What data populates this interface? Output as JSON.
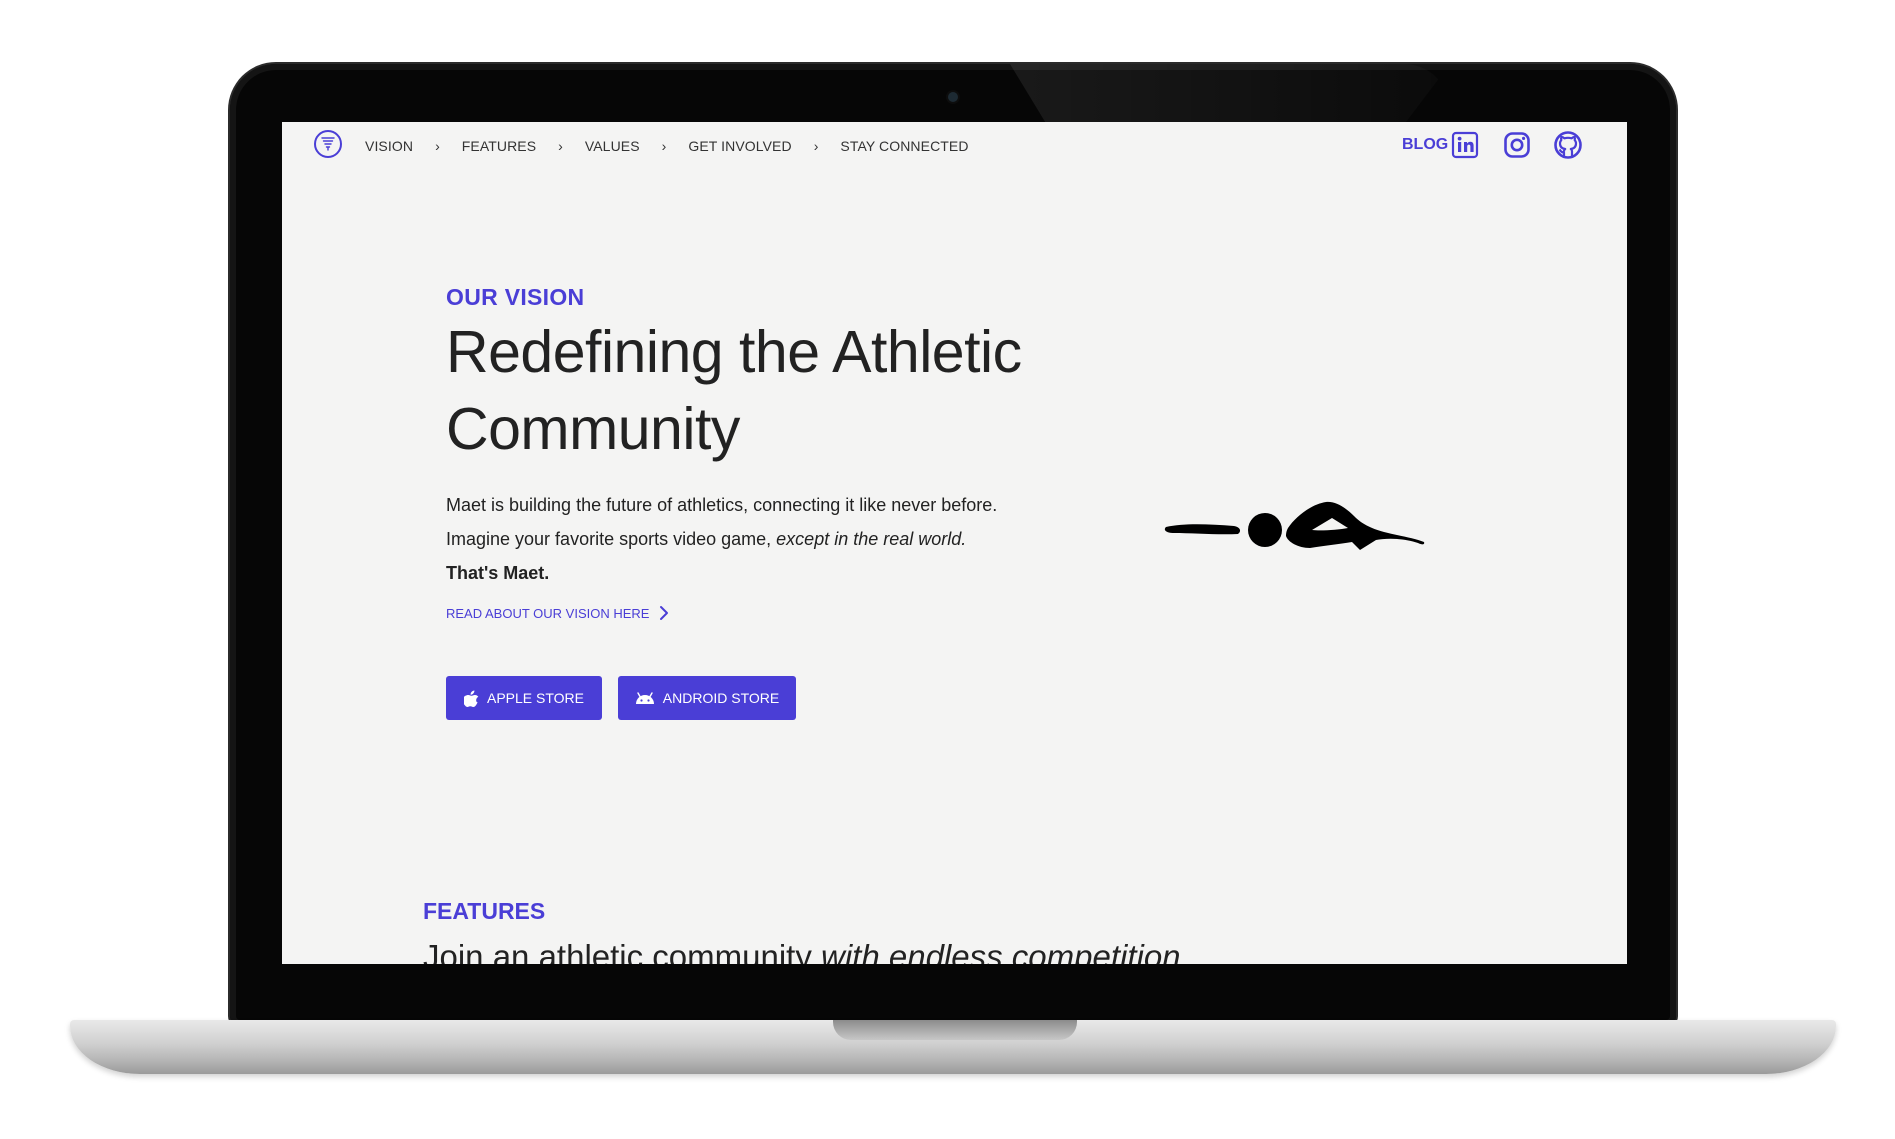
{
  "nav": {
    "logo_icon": "maet-logo-icon",
    "links": [
      "VISION",
      "FEATURES",
      "VALUES",
      "GET INVOLVED",
      "STAY CONNECTED"
    ],
    "separator": "›",
    "blog_label": "BLOG",
    "social_icons": [
      "linkedin-icon",
      "instagram-icon",
      "github-icon"
    ]
  },
  "hero": {
    "eyebrow": "OUR VISION",
    "title": "Redefining the Athletic Community",
    "line1": "Maet is building the future of athletics, connecting it like never before.",
    "line2_plain": "Imagine your favorite sports video game, ",
    "line2_em": "except in the real world.",
    "line3": "That's Maet.",
    "read_more": "READ ABOUT OUR VISION HERE",
    "buttons": {
      "apple": "APPLE STORE",
      "android": "ANDROID STORE"
    },
    "illustration": "swimmer-icon"
  },
  "features": {
    "eyebrow": "FEATURES",
    "title_plain": "Join an athletic community ",
    "title_em": "with endless competition"
  },
  "colors": {
    "accent": "#4a3ed6",
    "text": "#222222",
    "page_bg": "#f4f4f3"
  }
}
